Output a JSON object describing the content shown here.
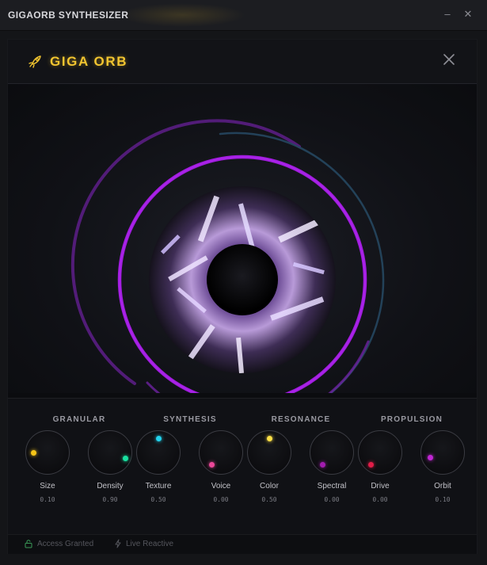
{
  "window": {
    "title": "GIGAORB SYNTHESIZER",
    "minimize_glyph": "–",
    "close_glyph": "✕"
  },
  "header": {
    "app_name": "GIGA ORB",
    "icon": "rocket-icon",
    "close_icon": "close-icon",
    "accent_color": "#f2c530"
  },
  "visualizer": {
    "ring_color": "#a21ce0",
    "outer_arc_color": "#2b4a60"
  },
  "sections": [
    {
      "title": "GRANULAR",
      "knobs": [
        {
          "label": "Size",
          "value": "0.10",
          "color": "#f5c518"
        },
        {
          "label": "Density",
          "value": "0.90",
          "color": "#19e0a0"
        }
      ]
    },
    {
      "title": "SYNTHESIS",
      "knobs": [
        {
          "label": "Texture",
          "value": "0.50",
          "color": "#22d3ee"
        },
        {
          "label": "Voice",
          "value": "0.00",
          "color": "#ec4899"
        }
      ]
    },
    {
      "title": "RESONANCE",
      "knobs": [
        {
          "label": "Color",
          "value": "0.50",
          "color": "#fde047"
        },
        {
          "label": "Spectral",
          "value": "0.00",
          "color": "#a21caf"
        }
      ]
    },
    {
      "title": "PROPULSION",
      "knobs": [
        {
          "label": "Drive",
          "value": "0.00",
          "color": "#e11d48"
        },
        {
          "label": "Orbit",
          "value": "0.10",
          "color": "#c026d3"
        }
      ]
    }
  ],
  "status": {
    "access": "Access Granted",
    "access_icon": "lock-icon",
    "live": "Live Reactive",
    "live_icon": "bolt-icon"
  }
}
